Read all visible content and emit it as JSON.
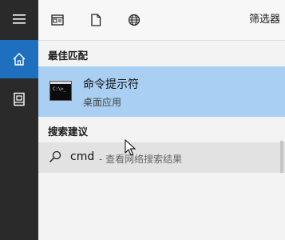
{
  "rail": {
    "items": [
      {
        "icon": "hamburger-icon"
      },
      {
        "icon": "home-icon",
        "active": true
      },
      {
        "icon": "document-icon"
      }
    ]
  },
  "topbar": {
    "icons": [
      "app-icon",
      "file-icon",
      "globe-icon"
    ],
    "filter_label": "筛选器"
  },
  "best_match": {
    "title": "最佳匹配",
    "item": {
      "name": "命令提示符",
      "subtitle": "桌面应用",
      "icon_text": "C:\\>_"
    }
  },
  "suggestions": {
    "title": "搜索建议",
    "item": {
      "query": "cmd",
      "hint": "- 查看网络搜索结果"
    }
  },
  "colors": {
    "rail_bg": "#2a2a2a",
    "accent": "#1f6fbf",
    "selected_bg": "#a9d0f2",
    "panel_bg": "#f3f3f3"
  }
}
